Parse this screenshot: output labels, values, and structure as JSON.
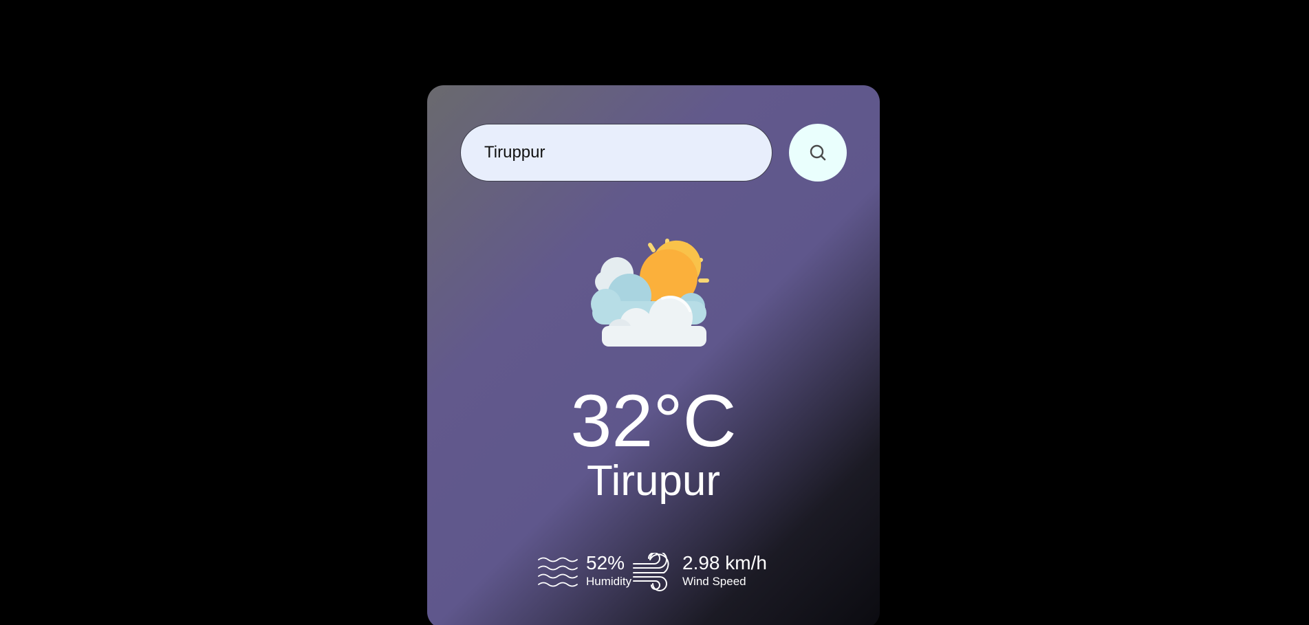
{
  "search": {
    "value": "Tiruppur",
    "button_icon": "search-icon"
  },
  "weather": {
    "icon": "partly-cloudy-sun-icon",
    "temperature": "32°C",
    "city": "Tirupur"
  },
  "details": {
    "humidity": {
      "icon": "humidity-waves-icon",
      "value": "52%",
      "label": "Humidity"
    },
    "wind": {
      "icon": "wind-icon",
      "value": "2.98 km/h",
      "label": "Wind Speed"
    }
  },
  "colors": {
    "page_background": "#000000",
    "card_gradient_start": "#6a6a6e",
    "card_gradient_mid": "#5f578c",
    "card_gradient_end": "#0b0b10",
    "search_input_bg": "#e8eefc",
    "search_button_bg": "#eafffd",
    "text": "#ffffff"
  }
}
